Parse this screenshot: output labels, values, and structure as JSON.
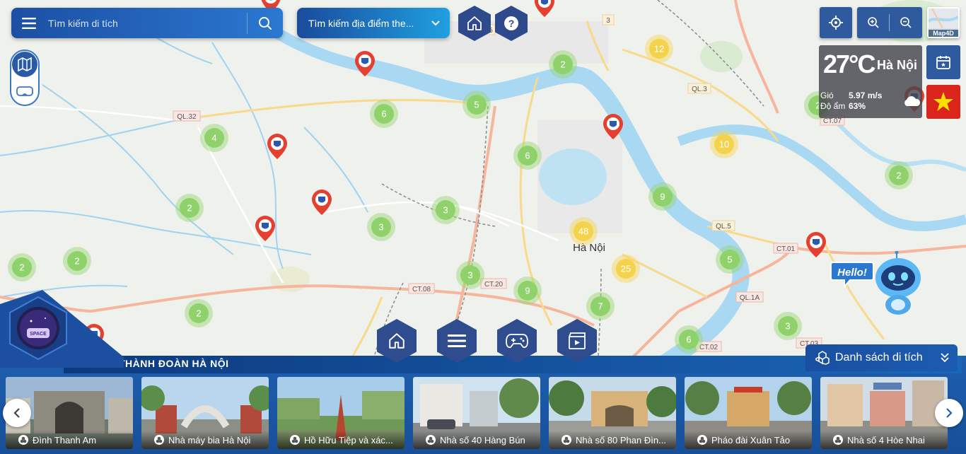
{
  "search": {
    "placeholder": "Tìm kiếm di tích"
  },
  "place_search": {
    "label": "Tìm kiếm địa điểm the..."
  },
  "map": {
    "city_label": "Hà Nội",
    "road_labels": [
      "QL.32",
      "QL.3",
      "QL.5",
      "CT.01",
      "CT.07",
      "CT.08",
      "CT.20",
      "QL.1A",
      "CT.02",
      "CT.03",
      "3",
      "5"
    ],
    "clusters": [
      {
        "count": "2"
      },
      {
        "count": "12"
      },
      {
        "count": "6"
      },
      {
        "count": "5"
      },
      {
        "count": "4"
      },
      {
        "count": "6"
      },
      {
        "count": "10"
      },
      {
        "count": "2"
      },
      {
        "count": "2"
      },
      {
        "count": "9"
      },
      {
        "count": "3"
      },
      {
        "count": "3"
      },
      {
        "count": "48"
      },
      {
        "count": "2"
      },
      {
        "count": "2"
      },
      {
        "count": "5"
      },
      {
        "count": "25"
      },
      {
        "count": "3"
      },
      {
        "count": "9"
      },
      {
        "count": "2"
      },
      {
        "count": "7"
      },
      {
        "count": "3"
      },
      {
        "count": "6"
      },
      {
        "count": "2"
      }
    ]
  },
  "controls": {
    "map4d_label": "Map4D"
  },
  "weather": {
    "temperature": "27°C",
    "city": "Hà Nội",
    "wind_label": "Gió",
    "wind_value": "5.97 m/s",
    "humidity_label": "Độ ẩm",
    "humidity_value": "63%"
  },
  "assistant": {
    "greeting": "Hello!"
  },
  "logo": {
    "text": "SPACE"
  },
  "bottom": {
    "org_name": "THÀNH ĐOÀN HÀ NỘI",
    "list_button": "Danh sách di tích",
    "cards": [
      {
        "title": "Đình Thanh Am"
      },
      {
        "title": "Nhà máy bia Hà Nội"
      },
      {
        "title": "Hồ Hữu Tiệp và xác..."
      },
      {
        "title": "Nhà số 40 Hàng Bún"
      },
      {
        "title": "Nhà số 80 Phan Đìn..."
      },
      {
        "title": "Pháo đài Xuân Tảo"
      },
      {
        "title": "Nhà số 4 Hòe Nhai"
      }
    ]
  },
  "colors": {
    "primary": "#2f5b9e",
    "cluster_green": "#8fd16a",
    "cluster_yellow": "#f5d24c",
    "river": "#a9d8f2",
    "marker_red": "#e5402f"
  }
}
